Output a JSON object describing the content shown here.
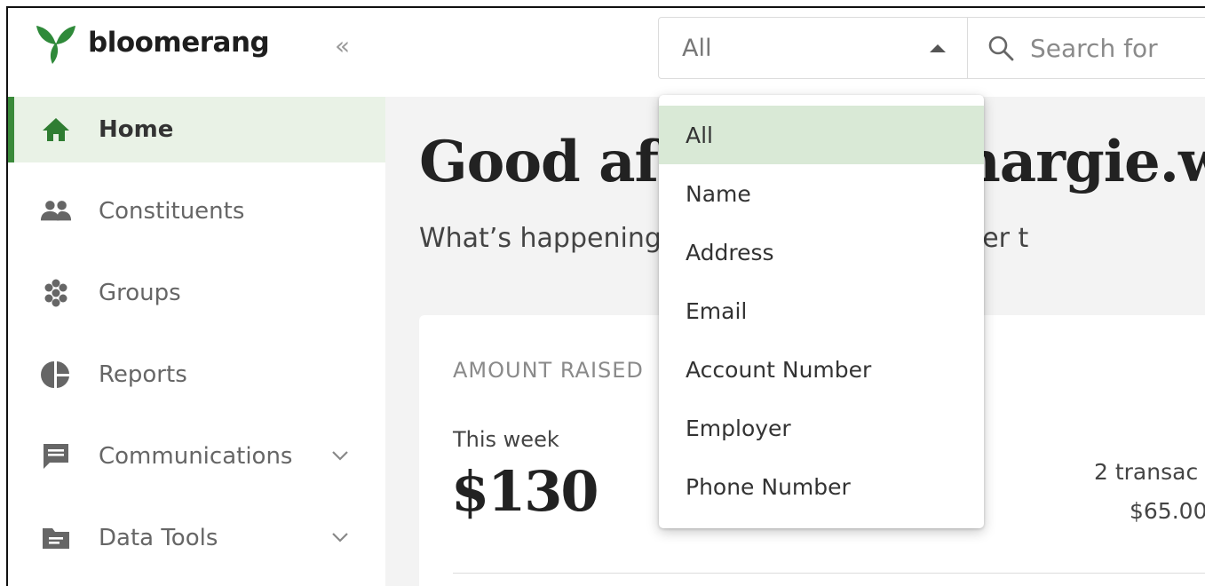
{
  "brand": {
    "name": "bloomerang",
    "color": "#2f8a3a"
  },
  "header": {
    "collapse_label": "«",
    "search": {
      "scope_value": "All",
      "placeholder": "Search for"
    }
  },
  "sidebar": {
    "items": [
      {
        "label": "Home",
        "icon": "home-icon",
        "active": true
      },
      {
        "label": "Constituents",
        "icon": "people-icon"
      },
      {
        "label": "Groups",
        "icon": "groups-icon"
      },
      {
        "label": "Reports",
        "icon": "pie-chart-icon"
      },
      {
        "label": "Communications",
        "icon": "message-icon",
        "expandable": true
      },
      {
        "label": "Data Tools",
        "icon": "folder-icon",
        "expandable": true
      }
    ]
  },
  "main": {
    "greeting": "Good afternoon, margie.w",
    "subtitle": "What’s happening at the Community Center t",
    "card": {
      "title": "AMOUNT RAISED",
      "period": "This week",
      "amount": "$130",
      "transactions": "2 transac",
      "average": "$65.00"
    }
  },
  "dropdown": {
    "options": [
      "All",
      "Name",
      "Address",
      "Email",
      "Account Number",
      "Employer",
      "Phone Number"
    ],
    "selected": "All"
  },
  "colors": {
    "accent_green": "#3a8a3a",
    "selected_bg": "#d9e9d6",
    "active_nav_bg": "#e9f2e6"
  }
}
